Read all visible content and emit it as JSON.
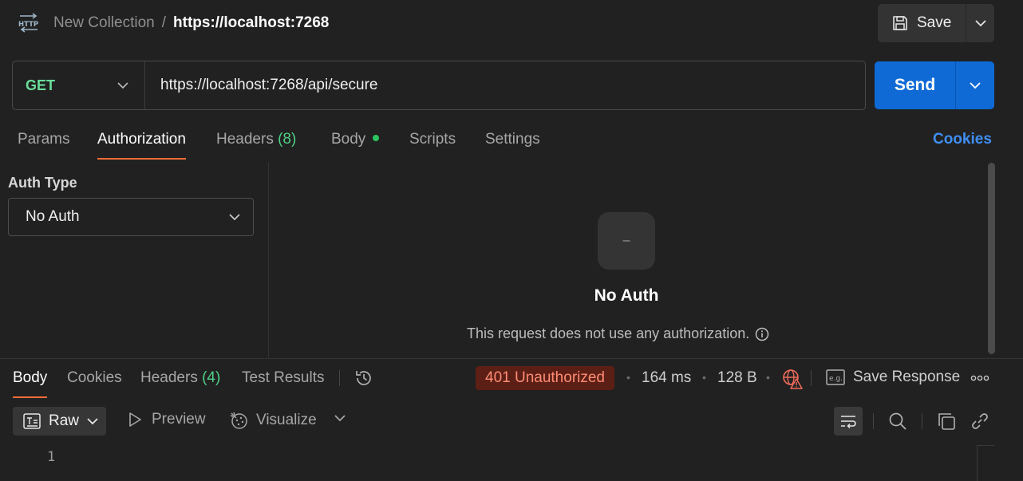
{
  "header": {
    "protocol_icon": "http-icon",
    "breadcrumb_parent": "New Collection",
    "breadcrumb_separator": "/",
    "breadcrumb_current": "https://localhost:7268",
    "save_label": "Save"
  },
  "request": {
    "method": "GET",
    "url": "https://localhost:7268/api/secure",
    "send_label": "Send"
  },
  "request_tabs": [
    {
      "label": "Params"
    },
    {
      "label": "Authorization",
      "active": true
    },
    {
      "label": "Headers",
      "count": "(8)"
    },
    {
      "label": "Body",
      "dot": true
    },
    {
      "label": "Scripts"
    },
    {
      "label": "Settings"
    }
  ],
  "cookies_label": "Cookies",
  "auth": {
    "type_label": "Auth Type",
    "selected": "No Auth",
    "badge_symbol": "–",
    "title": "No Auth",
    "description": "This request does not use any authorization."
  },
  "response_tabs": [
    {
      "label": "Body",
      "active": true
    },
    {
      "label": "Cookies"
    },
    {
      "label": "Headers",
      "count": "(4)"
    },
    {
      "label": "Test Results"
    }
  ],
  "response_meta": {
    "status": "401 Unauthorized",
    "time": "164 ms",
    "size": "128 B",
    "save_response_label": "Save Response"
  },
  "response_toolbar": {
    "format": "Raw",
    "preview_label": "Preview",
    "visualize_label": "Visualize"
  },
  "editor": {
    "line_numbers": [
      "1"
    ]
  },
  "colors": {
    "accent_orange": "#ff6c37",
    "send_blue": "#0f6ad6",
    "method_green": "#6bdd9a",
    "error_red": "#ff8c73"
  }
}
